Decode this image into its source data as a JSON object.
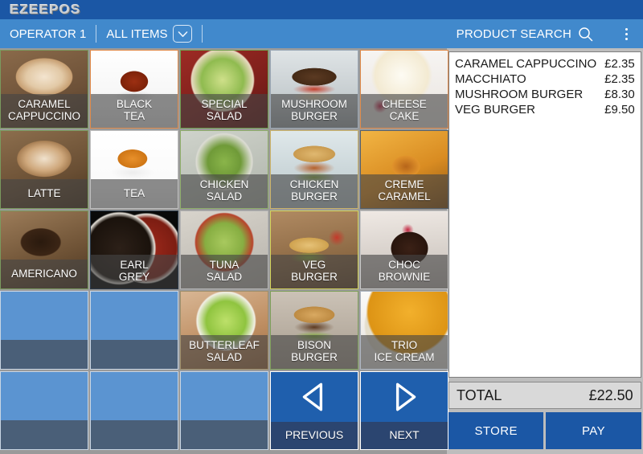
{
  "app": {
    "title": "EZEEPOS",
    "accent": "#1b57a5",
    "toolbar_color": "#4189cc"
  },
  "toolbar": {
    "operator": "OPERATOR 1",
    "category": "ALL ITEMS",
    "category_dropdown_icon": "chevron-down-icon",
    "search_label": "PRODUCT SEARCH",
    "search_icon": "search-icon",
    "menu_icon": "kebab-menu-icon"
  },
  "grid": {
    "rows": [
      [
        {
          "label1": "CARAMEL",
          "label2": "CAPPUCCINO",
          "type": "product",
          "border": "#7a9a5e",
          "img": "coffee-cappuccino"
        },
        {
          "label1": "BLACK",
          "label2": "TEA",
          "type": "product",
          "border": "#e08a4a",
          "img": "tea-black"
        },
        {
          "label1": "SPECIAL",
          "label2": "SALAD",
          "type": "product",
          "border": "#6f9d4f",
          "img": "salad-special"
        },
        {
          "label1": "MUSHROOM",
          "label2": "BURGER",
          "type": "product",
          "border": "#9aa7b5",
          "img": "burger-mushroom"
        },
        {
          "label1": "CHEESE",
          "label2": "CAKE",
          "type": "product",
          "border": "#e08a4a",
          "img": "cake-cheese"
        }
      ],
      [
        {
          "label1": "LATTE",
          "label2": "",
          "type": "product",
          "border": "#7a9a5e",
          "img": "coffee-latte"
        },
        {
          "label1": "TEA",
          "label2": "",
          "type": "product",
          "border": "#bfbfbf",
          "img": "tea-cup"
        },
        {
          "label1": "CHICKEN",
          "label2": "SALAD",
          "type": "product",
          "border": "#8fae6a",
          "img": "salad-chicken"
        },
        {
          "label1": "CHICKEN",
          "label2": "BURGER",
          "type": "product",
          "border": "#cbb36a",
          "img": "burger-chicken"
        },
        {
          "label1": "CREME",
          "label2": "CARAMEL",
          "type": "product",
          "border": "#55606b",
          "img": "dessert-creme-caramel"
        }
      ],
      [
        {
          "label1": "AMERICANO",
          "label2": "",
          "type": "product",
          "border": "#7a9a5e",
          "img": "coffee-americano"
        },
        {
          "label1": "EARL",
          "label2": "GREY",
          "type": "product",
          "border": "#2b3a4a",
          "img": "tea-earl-grey"
        },
        {
          "label1": "TUNA",
          "label2": "SALAD",
          "type": "product",
          "border": "#b5b5b5",
          "img": "salad-tuna"
        },
        {
          "label1": "VEG",
          "label2": "BURGER",
          "type": "product",
          "border": "#d4d45a",
          "img": "burger-veg"
        },
        {
          "label1": "CHOC",
          "label2": "BROWNIE",
          "type": "product",
          "border": "#c8c8c8",
          "img": "dessert-choc-brownie"
        }
      ],
      [
        {
          "label1": "",
          "label2": "",
          "type": "empty"
        },
        {
          "label1": "",
          "label2": "",
          "type": "empty"
        },
        {
          "label1": "BUTTERLEAF",
          "label2": "SALAD",
          "type": "product",
          "border": "#a08f6a",
          "img": "salad-butterleaf"
        },
        {
          "label1": "BISON",
          "label2": "BURGER",
          "type": "product",
          "border": "#7fa05a",
          "img": "burger-bison"
        },
        {
          "label1": "TRIO",
          "label2": "ICE CREAM",
          "type": "product",
          "border": "#aeb6c2",
          "img": "dessert-trio-ice-cream"
        }
      ],
      [
        {
          "label1": "",
          "label2": "",
          "type": "empty"
        },
        {
          "label1": "",
          "label2": "",
          "type": "empty"
        },
        {
          "label1": "",
          "label2": "",
          "type": "empty"
        },
        {
          "label1": "PREVIOUS",
          "label2": "",
          "type": "nav",
          "icon": "arrow-left-icon"
        },
        {
          "label1": "NEXT",
          "label2": "",
          "type": "nav",
          "icon": "arrow-right-icon"
        }
      ]
    ]
  },
  "receipt": {
    "items": [
      {
        "name": "CARAMEL CAPPUCCINO",
        "price": "£2.35"
      },
      {
        "name": "MACCHIATO",
        "price": "£2.35"
      },
      {
        "name": "MUSHROOM BURGER",
        "price": "£8.30"
      },
      {
        "name": "VEG BURGER",
        "price": "£9.50"
      }
    ],
    "total_label": "TOTAL",
    "total_value": "£22.50",
    "store_label": "STORE",
    "pay_label": "PAY"
  }
}
